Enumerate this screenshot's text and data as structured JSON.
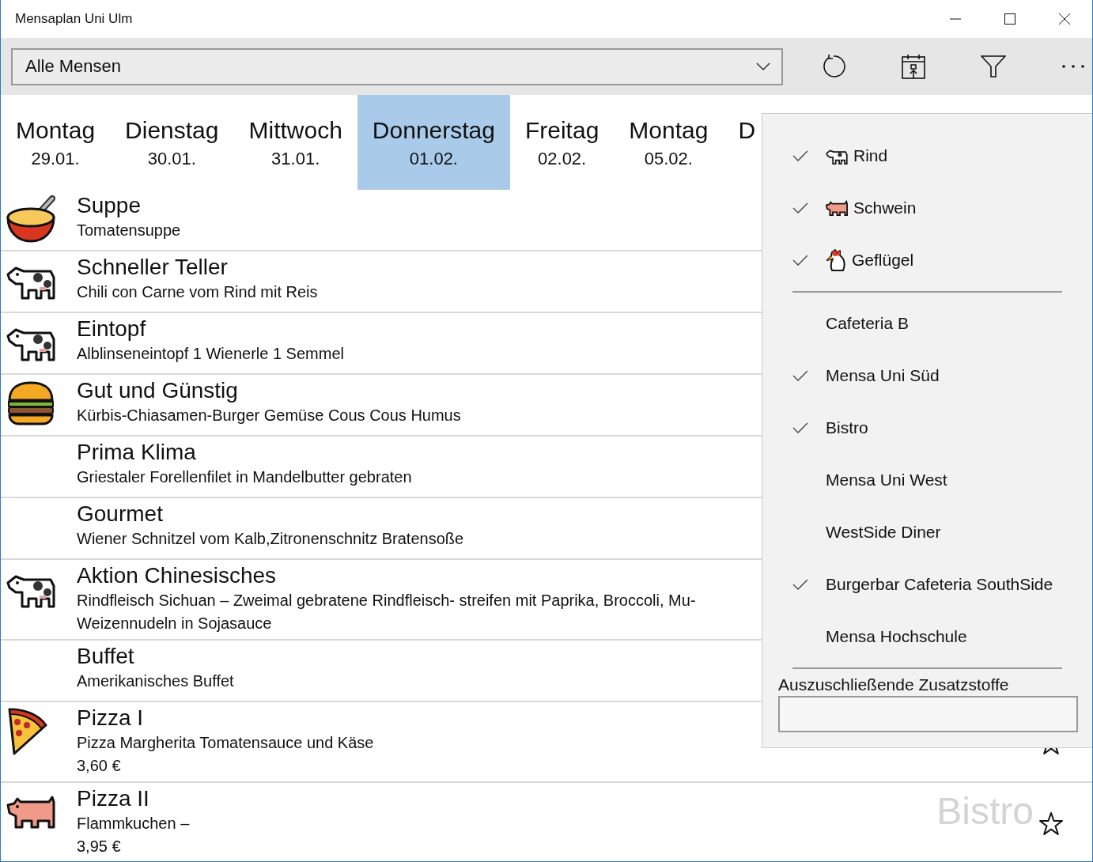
{
  "window": {
    "title": "Mensaplan Uni Ulm"
  },
  "toolbar": {
    "mensa_select": {
      "value": "Alle Mensen"
    }
  },
  "days": [
    {
      "weekday": "Montag",
      "date": "29.01.",
      "selected": false
    },
    {
      "weekday": "Dienstag",
      "date": "30.01.",
      "selected": false
    },
    {
      "weekday": "Mittwoch",
      "date": "31.01.",
      "selected": false
    },
    {
      "weekday": "Donnerstag",
      "date": "01.02.",
      "selected": true
    },
    {
      "weekday": "Freitag",
      "date": "02.02.",
      "selected": false
    },
    {
      "weekday": "Montag",
      "date": "05.02.",
      "selected": false
    },
    {
      "weekday": "D",
      "selected": false
    }
  ],
  "meals": [
    {
      "kind": "soup",
      "title": "Suppe",
      "lines": [
        "Tomatensuppe"
      ]
    },
    {
      "kind": "cow",
      "title": "Schneller Teller",
      "lines": [
        "Chili con Carne vom Rind mit Reis"
      ]
    },
    {
      "kind": "cow",
      "title": "Eintopf",
      "lines": [
        "Alblinseneintopf 1 Wienerle 1 Semmel"
      ]
    },
    {
      "kind": "burger",
      "title": "Gut und Günstig",
      "lines": [
        "Kürbis-Chiasamen-Burger Gemüse Cous Cous Humus"
      ]
    },
    {
      "kind": "plain",
      "title": "Prima Klima",
      "lines": [
        "Griestaler Forellenfilet in Mandelbutter gebraten"
      ]
    },
    {
      "kind": "plain",
      "title": "Gourmet",
      "lines": [
        "Wiener Schnitzel vom Kalb,Zitronenschnitz Bratensoße"
      ]
    },
    {
      "kind": "cow",
      "title": "Aktion Chinesisches",
      "lines": [
        "Rindfleisch Sichuan – Zweimal gebratene Rindfleisch- streifen mit Paprika, Broccoli, Mu-",
        "Weizennudeln in Sojasauce"
      ]
    },
    {
      "kind": "plain",
      "title": "Buffet",
      "lines": [
        "Amerikanisches Buffet"
      ]
    },
    {
      "kind": "pizza",
      "title": "Pizza I",
      "lines": [
        "Pizza Margherita Tomatensauce und Käse"
      ],
      "price": "3,60 €",
      "favorite": false
    },
    {
      "kind": "pig",
      "title": "Pizza II",
      "lines": [
        "Flammkuchen –"
      ],
      "price": "3,95 €",
      "location": "Bistro",
      "favorite": false
    }
  ],
  "filter_flyout": {
    "sections": [
      [
        {
          "kind": "cow",
          "label": "Rind",
          "checked": true
        },
        {
          "kind": "pig",
          "label": "Schwein",
          "checked": true
        },
        {
          "kind": "chicken",
          "label": "Geflügel",
          "checked": true
        }
      ],
      [
        {
          "kind": "plain",
          "label": "Cafeteria B",
          "checked": false
        },
        {
          "kind": "plain",
          "label": "Mensa Uni Süd",
          "checked": true
        },
        {
          "kind": "plain",
          "label": "Bistro",
          "checked": true
        },
        {
          "kind": "plain",
          "label": "Mensa Uni West",
          "checked": false
        },
        {
          "kind": "plain",
          "label": "WestSide Diner",
          "checked": false
        },
        {
          "kind": "plain",
          "label": "Burgerbar Cafeteria SouthSide",
          "checked": true
        },
        {
          "kind": "plain",
          "label": "Mensa Hochschule",
          "checked": false
        }
      ]
    ],
    "additives_label": "Auszuschließende Zusatzstoffe"
  }
}
